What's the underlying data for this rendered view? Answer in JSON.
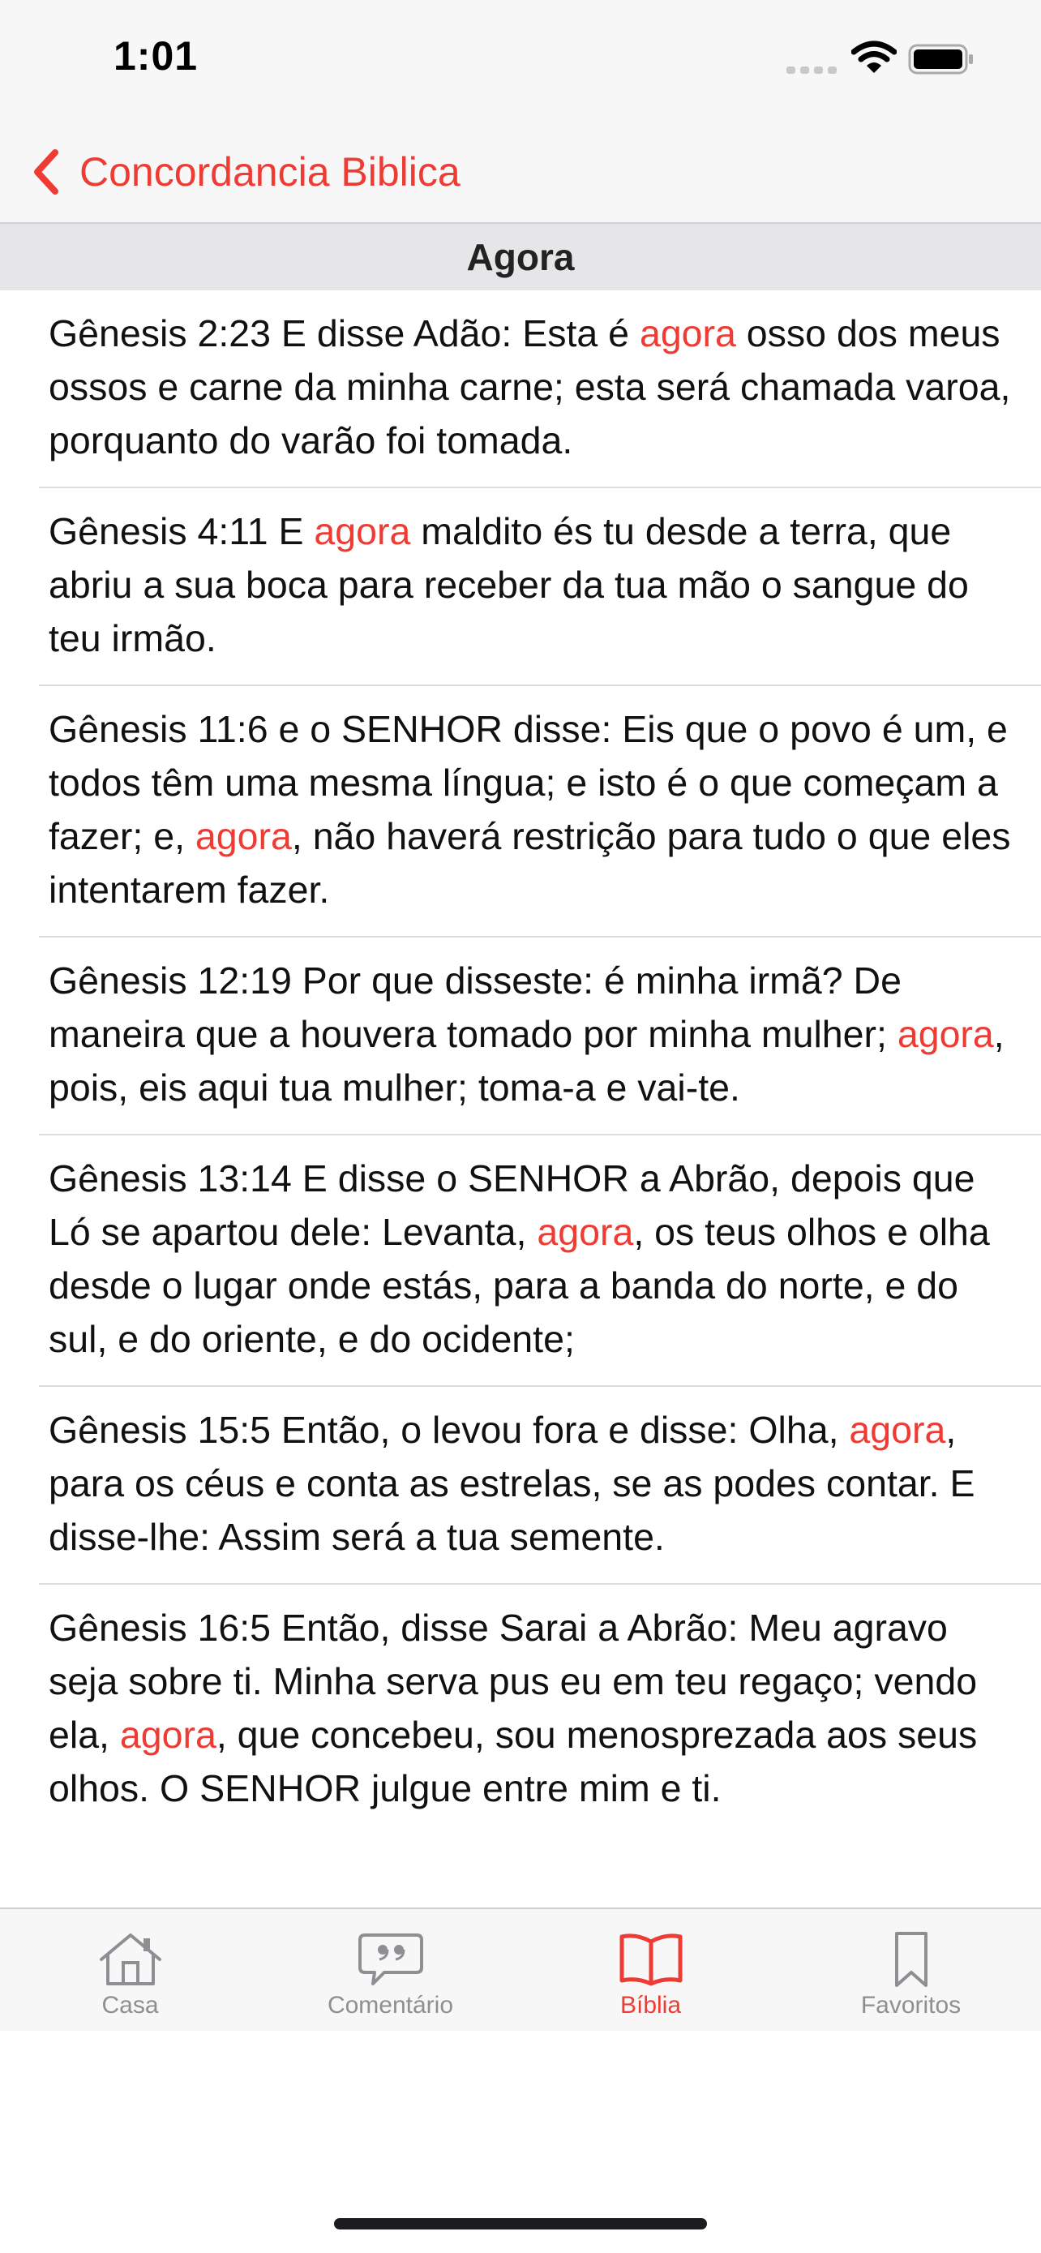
{
  "status": {
    "time": "1:01"
  },
  "nav": {
    "back_label": "Concordancia Biblica"
  },
  "section": {
    "title": "Agora"
  },
  "verses": [
    {
      "before": "Gênesis 2:23 E disse Adão: Esta é ",
      "keyword": "agora",
      "after": " osso dos meus ossos e carne da minha carne; esta será chamada varoa, porquanto do varão foi tomada."
    },
    {
      "before": "Gênesis 4:11 E ",
      "keyword": "agora",
      "after": " maldito és tu desde a terra, que abriu a sua boca para receber da tua mão o sangue do teu irmão."
    },
    {
      "before": "Gênesis 11:6 e o SENHOR disse: Eis que o povo é um, e todos têm uma mesma língua; e isto é o que começam a fazer; e, ",
      "keyword": "agora",
      "after": ", não haverá restrição para tudo o que eles intentarem fazer."
    },
    {
      "before": "Gênesis 12:19 Por que disseste: é minha irmã? De maneira que a houvera tomado por minha mulher; ",
      "keyword": "agora",
      "after": ", pois, eis aqui tua mulher; toma-a e vai-te."
    },
    {
      "before": "Gênesis 13:14 E disse o SENHOR a Abrão, depois que Ló se apartou dele: Levanta, ",
      "keyword": "agora",
      "after": ", os teus olhos e olha desde o lugar onde estás, para a banda do norte, e do sul, e do oriente, e do ocidente;"
    },
    {
      "before": "Gênesis 15:5 Então, o levou fora e disse: Olha, ",
      "keyword": "agora",
      "after": ", para os céus e conta as estrelas, se as podes contar. E disse-lhe: Assim será a tua semente."
    },
    {
      "before": "Gênesis 16:5 Então, disse Sarai a Abrão: Meu agravo seja sobre ti. Minha serva pus eu em teu regaço; vendo ela, ",
      "keyword": "agora",
      "after": ", que concebeu, sou menosprezada aos seus olhos. O SENHOR julgue entre mim e ti."
    }
  ],
  "tabs": [
    {
      "label": "Casa",
      "icon": "house-icon",
      "active": false
    },
    {
      "label": "Comentário",
      "icon": "comment-bubble-icon",
      "active": false
    },
    {
      "label": "Bíblia",
      "icon": "open-book-icon",
      "active": true
    },
    {
      "label": "Favoritos",
      "icon": "bookmark-icon",
      "active": false
    }
  ],
  "colors": {
    "accent": "#ee3b33",
    "inactive": "#8e8e93"
  }
}
